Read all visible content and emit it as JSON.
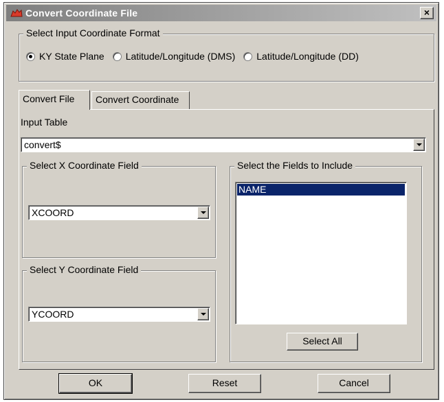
{
  "window": {
    "title": "Convert Coordinate File",
    "close_glyph": "×",
    "icon": "app-icon"
  },
  "format_group": {
    "label": "Select Input Coordinate Format",
    "options": [
      {
        "label": "KY State Plane",
        "checked": true
      },
      {
        "label": "Latitude/Longitude (DMS)",
        "checked": false
      },
      {
        "label": "Latitude/Longitude (DD)",
        "checked": false
      }
    ]
  },
  "tabs": [
    {
      "label": "Convert File",
      "active": true
    },
    {
      "label": "Convert Coordinate",
      "active": false
    }
  ],
  "input_table": {
    "label": "Input Table",
    "value": "convert$"
  },
  "x_group": {
    "label": "Select X Coordinate Field",
    "value": "XCOORD"
  },
  "y_group": {
    "label": "Select Y Coordinate Field",
    "value": "YCOORD"
  },
  "fields_group": {
    "label": "Select the Fields to Include",
    "items": [
      {
        "label": "NAME",
        "selected": true
      }
    ],
    "select_all_label": "Select All"
  },
  "buttons": {
    "ok": "OK",
    "reset": "Reset",
    "cancel": "Cancel"
  }
}
